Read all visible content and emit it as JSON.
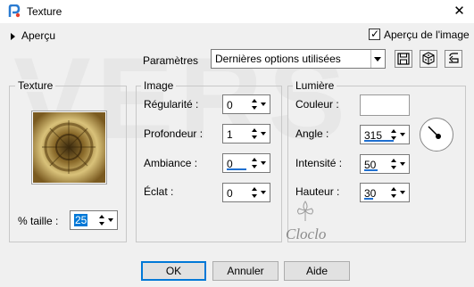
{
  "window": {
    "title": "Texture",
    "close_glyph": "✕"
  },
  "preview": {
    "toggle_label": "Aperçu",
    "image_preview_label": "Aperçu de l'image",
    "image_preview_checked": true
  },
  "parameters": {
    "label": "Paramètres",
    "preset_value": "Dernières options utilisées"
  },
  "texture_group": {
    "title": "Texture",
    "size_label": "% taille :",
    "size_value": "25"
  },
  "image_group": {
    "title": "Image",
    "regularity_label": "Régularité :",
    "regularity_value": "0",
    "depth_label": "Profondeur :",
    "depth_value": "1",
    "ambiance_label": "Ambiance :",
    "ambiance_value": "0",
    "shine_label": "Éclat :",
    "shine_value": "0"
  },
  "light_group": {
    "title": "Lumière",
    "color_label": "Couleur :",
    "angle_label": "Angle :",
    "angle_value": "315",
    "intensity_label": "Intensité :",
    "intensity_value": "50",
    "height_label": "Hauteur :",
    "height_value": "30"
  },
  "watermark": {
    "large_text": "VERS",
    "signature": "Cloclo"
  },
  "buttons": {
    "ok": "OK",
    "cancel": "Annuler",
    "help": "Aide"
  },
  "colors": {
    "accent": "#0078d7",
    "slider_fill": "#1e6fd0",
    "dialog_bg": "#f0f0f0",
    "title_bg": "#ffffff"
  },
  "icons": {
    "app": "paintshop-icon",
    "save": "save-preset-icon",
    "random": "random-dice-icon",
    "reset": "reset-icon"
  }
}
